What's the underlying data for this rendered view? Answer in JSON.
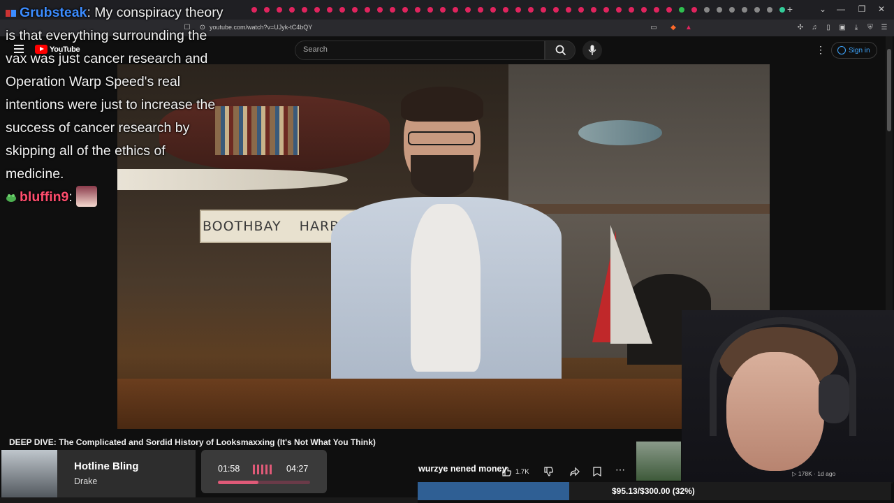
{
  "browser": {
    "url": "youtube.com/watch?v=UJyk-tC4bQY",
    "tab_colors": [
      "#e0245e",
      "#e0245e",
      "#e0245e",
      "#e0245e",
      "#e0245e",
      "#e0245e",
      "#e0245e",
      "#e0245e",
      "#e0245e",
      "#e0245e",
      "#e0245e",
      "#e0245e",
      "#e0245e",
      "#e0245e",
      "#e0245e",
      "#e0245e",
      "#e0245e",
      "#e0245e",
      "#e0245e",
      "#e0245e",
      "#e0245e",
      "#e0245e",
      "#e0245e",
      "#e0245e",
      "#e0245e",
      "#e0245e",
      "#e0245e",
      "#e0245e",
      "#e0245e",
      "#e0245e",
      "#e0245e",
      "#e0245e",
      "#e0245e",
      "#e0245e",
      "#2fbf4f",
      "#e0245e",
      "#888888",
      "#888888",
      "#888888",
      "#888888",
      "#888888",
      "#888888",
      "#33cc99",
      "#33cc99",
      "#888888",
      "#22bbee",
      "#22bbee",
      "#e8d21e",
      "#33cc99",
      "#33cc99",
      "#33cc99",
      "#888888",
      "#888888",
      "#888888",
      "#888888",
      "#e0245e",
      "#e0245e"
    ]
  },
  "youtube": {
    "logo_text": "YouTube",
    "search_placeholder": "Search",
    "signin_label": "Sign in",
    "accent": "#ff0000",
    "link_color": "#3ea6ff"
  },
  "chat": {
    "user1": "Grubsteak",
    "message_first": ": My conspiracy theory",
    "message_lines": [
      "is that everything surrounding the",
      "vax was just cancer research and",
      "Operation Warp Speed's real",
      "intentions were just to increase the",
      "success of cancer research by",
      "skipping all of the ethics of",
      "medicine."
    ],
    "user2": "bluffin9",
    "user2_sep": ":"
  },
  "video": {
    "sign_words": [
      "BOOTHBAY",
      "HARBOR"
    ],
    "title": "DEEP DIVE: The Complicated and Sordid History of Looksmaxxing (It's Not What You Think)"
  },
  "now_playing": {
    "song": "Hotline Bling",
    "artist": "Drake",
    "time_current": "01:58",
    "time_total": "04:27",
    "progress": 0.44
  },
  "actions": {
    "donor_text": "wurzye nened money",
    "like_count": "1.7K"
  },
  "goal": {
    "text": "$95.13/$300.00 (32%)",
    "fraction": 0.32
  },
  "sidebar": {
    "meta": "▷ 178K · 1d ago"
  }
}
